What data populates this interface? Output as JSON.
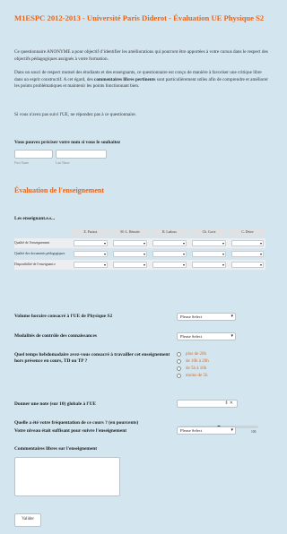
{
  "form": {
    "title": "M1ESPC 2012-2013 - Université Paris Diderot - Évaluation UE Physique S2",
    "intro": [
      "Ce questionnaire ANONYME a pour objectif d’identifier les améliorations qui pourront être apportées à votre cursus dans le respect des objectifs pédagogiques assignés à votre formation.",
      {
        "before": "Dans un souci de respect mutuel des étudiants et des enseignants, ce questionnaire est conçu de manière à favoriser une critique libre dans un esprit constructif. A cet égard, des ",
        "bold": "commentaires libres pertinents",
        "after": " sont particulièrement utiles afin de comprendre et améliorer les points problématiques et maintenir les points fonctionnant bien."
      },
      "Si vous n'avez pas suivi l'UE, ne répondez pas à ce questionnaire."
    ],
    "name": {
      "label": "Vous pouvez préciser votre nom si vous le souhaitez",
      "first_sublabel": "First Name",
      "last_sublabel": "Last Name",
      "first_value": "",
      "last_value": ""
    },
    "section_title": "Évaluation de l'enseignement",
    "teachers": {
      "label": "Les enseignant.e.s...",
      "columns": [
        "E. Parizot",
        "M.-L. Bénotte",
        "B. Ladoux",
        "Ch. Corte",
        "C. Detez"
      ],
      "rows": [
        "Qualité de l'enseignement",
        "Qualité des documents pédagogiques",
        "Disponibilité de l'enseignant.e"
      ]
    },
    "volume": {
      "label": "Volume horaire consacré à l'UE de Physique S2",
      "selected": "Please Select"
    },
    "modalites": {
      "label": "Modalités de contrôle des connaissances",
      "selected": "Please Select"
    },
    "temps": {
      "label": "Quel temps hebdomadaire avez-vous consacré à travailler cet enseignement hors présence en cours, TD ou TP ?",
      "options": [
        "plus de 20h",
        "de 10h à 20h",
        "de 5h à 10h",
        "moins de 5h"
      ]
    },
    "note": {
      "label": "Donner une note (sur 10) globale à l'UE",
      "value": ""
    },
    "frequentation": {
      "label": "Quelle a été votre fréquentation de ce cours ? (en pourcents)",
      "min": "0",
      "max": "100",
      "value_fraction": 0.5
    },
    "niveau": {
      "label": "Votre niveau était suffisant pour suivre l'enseignement",
      "selected": "Please Select"
    },
    "commentaires": {
      "label": "Commentaires libres sur l'enseignement",
      "value": ""
    },
    "submit_label": "Valider"
  }
}
